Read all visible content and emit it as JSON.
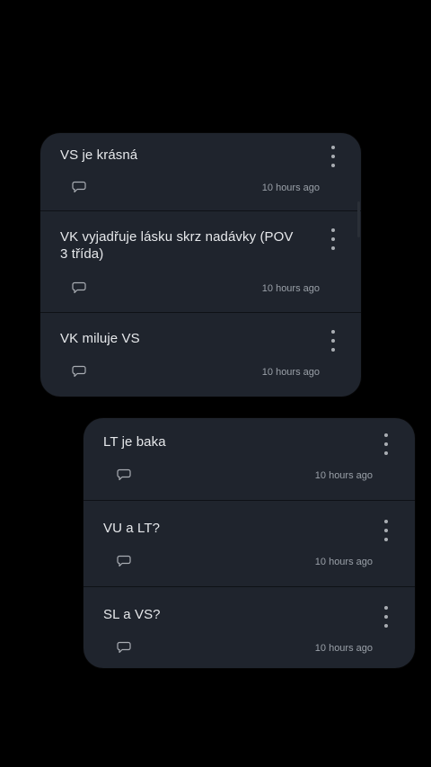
{
  "theme": {
    "background": "#000000",
    "card": "#1f242d",
    "divider": "#0e1116",
    "text_primary": "#e6e8eb",
    "text_secondary": "#9aa0a8",
    "icon": "#a9adb3"
  },
  "group_a": {
    "items": [
      {
        "title": "VS je krásná",
        "time": "10 hours ago",
        "icon": "comment-icon",
        "menu_icon": "more-vertical-icon"
      },
      {
        "title": "VK vyjadřuje lásku skrz nadávky (POV 3 třída)",
        "time": "10 hours ago",
        "icon": "comment-icon",
        "menu_icon": "more-vertical-icon"
      },
      {
        "title": "VK miluje VS",
        "time": "10 hours ago",
        "icon": "comment-icon",
        "menu_icon": "more-vertical-icon"
      }
    ]
  },
  "group_b": {
    "items": [
      {
        "title": "LT je baka",
        "time": "10 hours ago",
        "icon": "comment-icon",
        "menu_icon": "more-vertical-icon"
      },
      {
        "title": "VU a LT?",
        "time": "10 hours ago",
        "icon": "comment-icon",
        "menu_icon": "more-vertical-icon"
      },
      {
        "title": "SL a VS?",
        "time": "10 hours ago",
        "icon": "comment-icon",
        "menu_icon": "more-vertical-icon"
      }
    ]
  }
}
